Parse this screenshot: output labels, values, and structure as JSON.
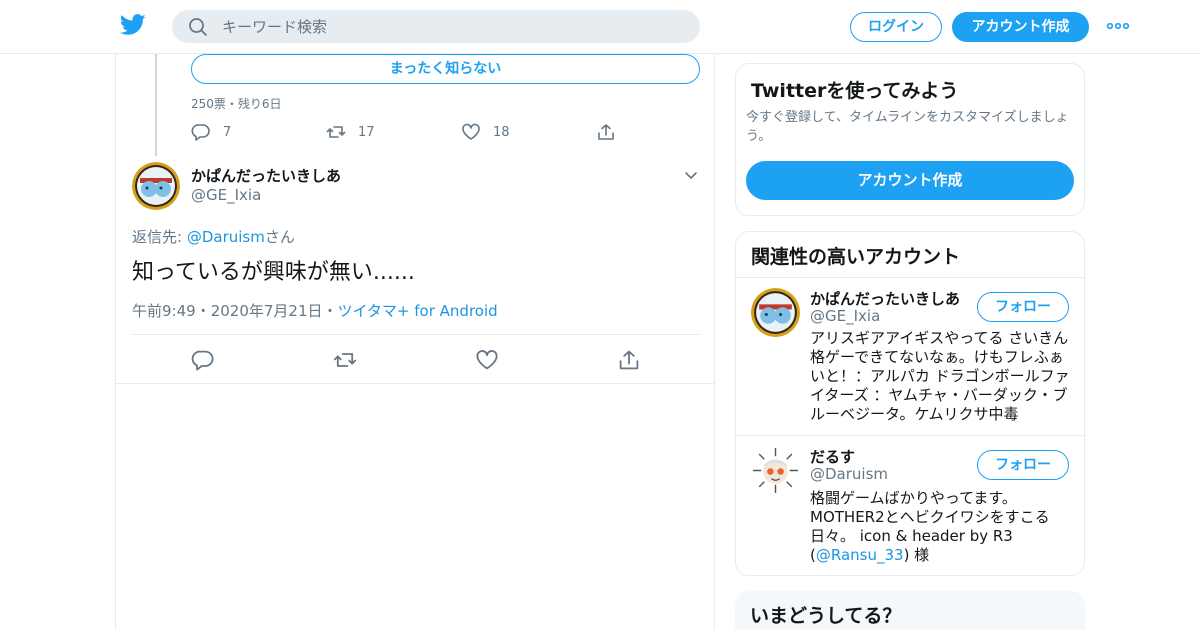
{
  "header": {
    "search_placeholder": "キーワード検索",
    "login_label": "ログイン",
    "signup_label": "アカウント作成",
    "brand_color": "#1da1f2"
  },
  "poll": {
    "option_label": "まったく知らない",
    "meta": "250票・残り6日"
  },
  "parent_tweet_actions": {
    "replies": "7",
    "retweets": "17",
    "likes": "18"
  },
  "tweet": {
    "display_name": "かぱんだったいきしあ",
    "handle": "@GE_Ixia",
    "reply_prefix": "返信先: ",
    "reply_to": "@Daruism",
    "reply_suffix": "さん",
    "text": "知っているが興味が無い......",
    "time": "午前9:49",
    "date": "2020年7月21日",
    "client": "ツイタマ+ for Android"
  },
  "sidebar": {
    "signup_card": {
      "title": "Twitterを使ってみよう",
      "description": "今すぐ登録して、タイムラインをカスタマイズしましょう。",
      "button": "アカウント作成"
    },
    "related": {
      "title": "関連性の高いアカウント",
      "accounts": [
        {
          "name": "かぱんだったいきしあ",
          "handle": "@GE_Ixia",
          "follow": "フォロー",
          "bio": "アリスギアアイギスやってる さいきん格ゲーできてないなぁ。けもフレふぁいと！：アルパカ ドラゴンボールファイターズ ：ヤムチャ・バーダック・ブルーベジータ。ケムリクサ中毒"
        },
        {
          "name": "だるす",
          "handle": "@Daruism",
          "follow": "フォロー",
          "bio_before": "格闘ゲームばかりやってます。MOTHER2とヘビクイワシをすこる日々。 icon & header by R3 (",
          "bio_link": "@Ransu_33",
          "bio_after": ") 様"
        }
      ]
    },
    "trends_title": "いまどうしてる？"
  }
}
